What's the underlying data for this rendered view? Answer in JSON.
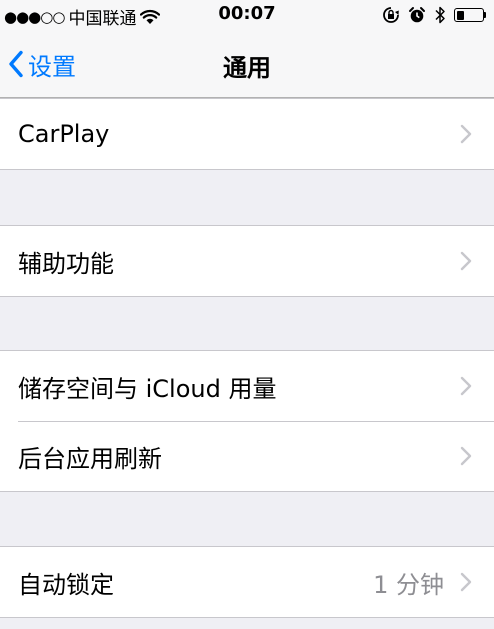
{
  "status_bar": {
    "signal": "●●●○○",
    "carrier": "中国联通",
    "time": "00:07"
  },
  "nav": {
    "back_label": "设置",
    "title": "通用"
  },
  "groups": [
    {
      "rows": [
        {
          "label": "CarPlay"
        }
      ]
    },
    {
      "rows": [
        {
          "label": "辅助功能"
        }
      ]
    },
    {
      "rows": [
        {
          "label": "储存空间与 iCloud 用量"
        },
        {
          "label": "后台应用刷新"
        }
      ]
    },
    {
      "rows": [
        {
          "label": "自动锁定",
          "value": "1 分钟"
        }
      ]
    }
  ],
  "icons": {
    "status_wifi": "wifi-icon",
    "status_lock": "rotation-lock-icon",
    "status_alarm": "alarm-icon",
    "status_bluetooth": "bluetooth-icon",
    "status_battery": "battery-icon",
    "nav_back": "chevron-left-icon",
    "row_disclosure": "chevron-right-icon"
  },
  "colors": {
    "accent": "#007aff",
    "background": "#efeff4",
    "chevron": "#c7c7cc",
    "secondary_text": "#8e8e93"
  }
}
